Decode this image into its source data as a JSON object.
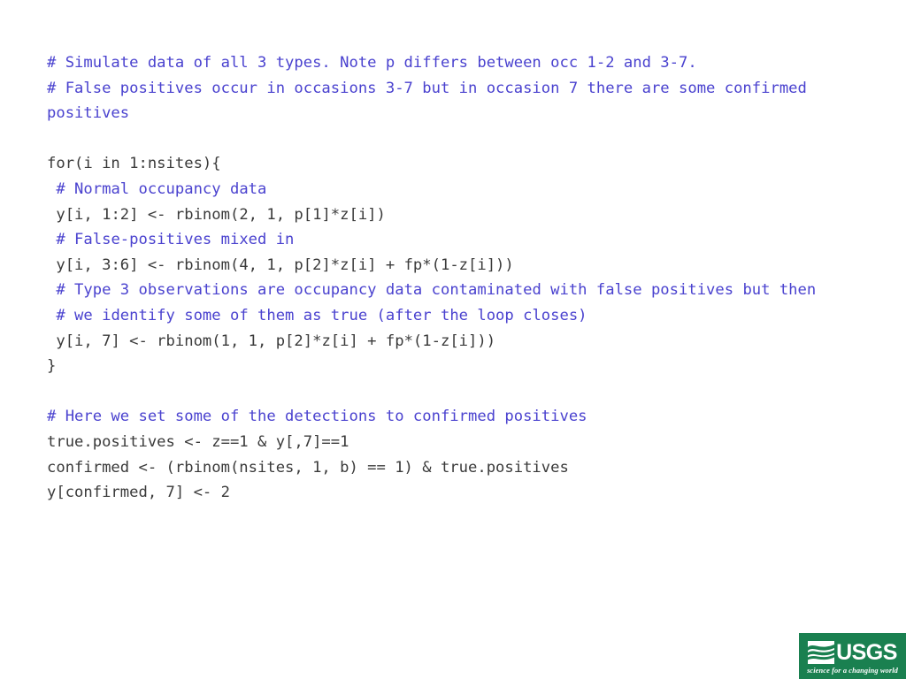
{
  "slide": {
    "background_color": "#ffffff",
    "comment_color": "#4a42cf",
    "code_color": "#3a3a3a"
  },
  "code_listing": {
    "language": "R",
    "lines": [
      {
        "type": "comment",
        "text": "# Simulate data of all 3 types. Note p differs between occ 1-2 and 3-7."
      },
      {
        "type": "comment",
        "text": "# False positives occur in occasions 3-7 but in occasion 7 there are some confirmed positives"
      },
      {
        "type": "blank",
        "text": " "
      },
      {
        "type": "code",
        "text": "for(i in 1:nsites){"
      },
      {
        "type": "comment",
        "text": " # Normal occupancy data"
      },
      {
        "type": "code",
        "text": " y[i, 1:2] <- rbinom(2, 1, p[1]*z[i])"
      },
      {
        "type": "comment",
        "text": " # False-positives mixed in"
      },
      {
        "type": "code",
        "text": " y[i, 3:6] <- rbinom(4, 1, p[2]*z[i] + fp*(1-z[i]))"
      },
      {
        "type": "comment",
        "text": " # Type 3 observations are occupancy data contaminated with false positives but then"
      },
      {
        "type": "comment",
        "text": " # we identify some of them as true (after the loop closes)"
      },
      {
        "type": "code",
        "text": " y[i, 7] <- rbinom(1, 1, p[2]*z[i] + fp*(1-z[i]))"
      },
      {
        "type": "code",
        "text": "}"
      },
      {
        "type": "blank",
        "text": " "
      },
      {
        "type": "comment",
        "text": "# Here we set some of the detections to confirmed positives"
      },
      {
        "type": "code",
        "text": "true.positives <- z==1 & y[,7]==1"
      },
      {
        "type": "code",
        "text": "confirmed <- (rbinom(nsites, 1, b) == 1) & true.positives"
      },
      {
        "type": "code",
        "text": "y[confirmed, 7] <- 2"
      }
    ]
  },
  "logo": {
    "name": "usgs-logo",
    "wordmark": "USGS",
    "tagline": "science for a changing world",
    "background_color": "#1a8050",
    "text_color": "#ffffff"
  }
}
